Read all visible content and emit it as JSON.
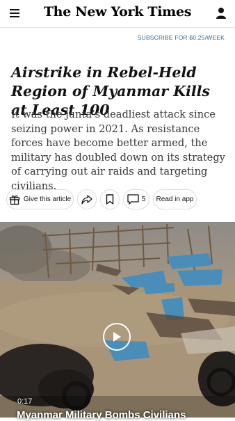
{
  "header": {
    "logo_text": "The New York Times",
    "subscribe_label": "SUBSCRIBE FOR $0.25/WEEK"
  },
  "article": {
    "headline": "Airstrike in Rebel-Held Region of Myanmar Kills at Least 100",
    "summary": "It was the junta’s deadliest attack since seizing power in 2021. As resistance forces have become better armed, the military has doubled down on its strategy of carrying out air raids and targeting civilians."
  },
  "actions": {
    "gift_label": "Give this article",
    "comment_count": "5",
    "read_in_app_label": "Read in app"
  },
  "video": {
    "duration": "0:17",
    "caption": "Myanmar Military Bombs Civilians"
  },
  "icons": [
    "menu-icon",
    "user-icon",
    "gift-icon",
    "share-icon",
    "bookmark-icon",
    "comment-icon",
    "play-icon"
  ],
  "colors": {
    "link": "#326891",
    "text": "#121212"
  }
}
